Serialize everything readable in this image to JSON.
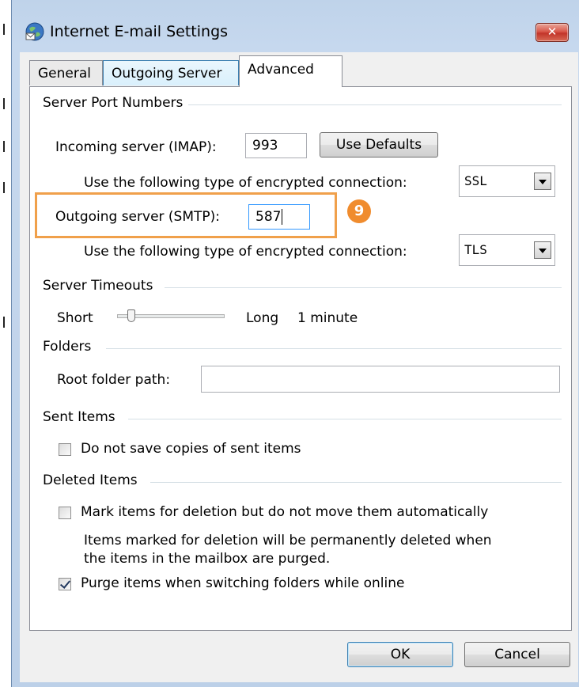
{
  "window": {
    "title": "Internet E-mail Settings",
    "close_label": "✕"
  },
  "tabs": [
    {
      "label": "General"
    },
    {
      "label": "Outgoing Server"
    },
    {
      "label": "Advanced"
    }
  ],
  "server_ports": {
    "group_label": "Server Port Numbers",
    "incoming_label": "Incoming server (IMAP):",
    "incoming_value": "993",
    "use_defaults_label": "Use Defaults",
    "incoming_encryption_label": "Use the following type of encrypted connection:",
    "incoming_encryption_value": "SSL",
    "outgoing_label": "Outgoing server (SMTP):",
    "outgoing_value": "587",
    "outgoing_encryption_label": "Use the following type of encrypted connection:",
    "outgoing_encryption_value": "TLS"
  },
  "server_timeouts": {
    "group_label": "Server Timeouts",
    "short_label": "Short",
    "long_label": "Long",
    "timeout_value": "1 minute",
    "slider_level": 0.1
  },
  "folders": {
    "group_label": "Folders",
    "root_folder_label": "Root folder path:",
    "root_folder_value": ""
  },
  "sent_items": {
    "group_label": "Sent Items",
    "do_not_save_label": "Do not save copies of sent items",
    "do_not_save_checked": false
  },
  "deleted_items": {
    "group_label": "Deleted Items",
    "mark_items_label": "Mark items for deletion but do not move them automatically",
    "mark_items_checked": false,
    "mark_items_note_line1": "Items marked for deletion will be permanently deleted when",
    "mark_items_note_line2": "the items in the mailbox are purged.",
    "purge_label": "Purge items when switching folders while online",
    "purge_checked": true
  },
  "buttons": {
    "ok_label": "OK",
    "cancel_label": "Cancel"
  },
  "annotation": {
    "step_number": "9",
    "highlight_color": "#f0a04b",
    "badge_color": "#f08c2e"
  }
}
